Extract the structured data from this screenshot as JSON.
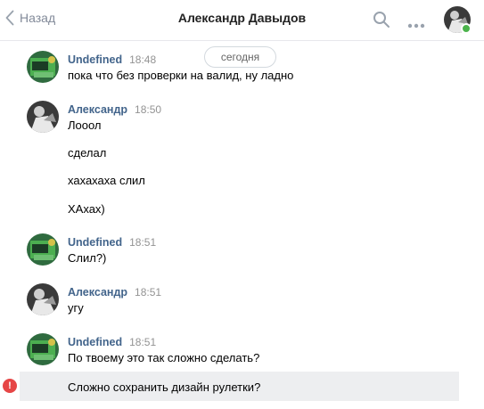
{
  "header": {
    "back_label": "Назад",
    "title": "Александр Давыдов"
  },
  "date_divider": "сегодня",
  "messages": [
    {
      "author": "Undefined",
      "time": "18:48",
      "lines": [
        "пока что без проверки на валид, ну ладно"
      ]
    },
    {
      "author": "Александр",
      "time": "18:50",
      "lines": [
        "Лооол",
        "сделал",
        "хахахаха слил",
        "ХАхах)"
      ]
    },
    {
      "author": "Undefined",
      "time": "18:51",
      "lines": [
        "Слил?)"
      ]
    },
    {
      "author": "Александр",
      "time": "18:51",
      "lines": [
        "угу"
      ]
    },
    {
      "author": "Undefined",
      "time": "18:51",
      "lines": [
        "По твоему это так сложно сделать?",
        "Сложно сохранить дизайн рулетки?"
      ]
    }
  ],
  "error_mark": "!",
  "colors": {
    "author_link": "#42648b",
    "muted": "#828a99",
    "online": "#4bb34b",
    "error": "#e64646",
    "highlight": "#edeef0"
  },
  "icons": [
    "chevron-left-icon",
    "search-icon",
    "more-icon",
    "online-dot",
    "error-icon"
  ]
}
